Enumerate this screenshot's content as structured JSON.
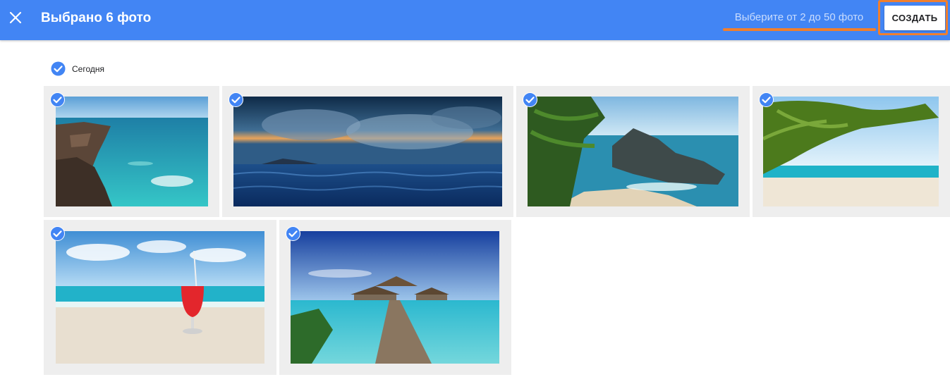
{
  "header": {
    "title": "Выбрано 6 фото",
    "hint": "Выберите от 2 до 50 фото",
    "create_label": "СОЗДАТЬ",
    "close_icon": "close-icon"
  },
  "section": {
    "date_label": "Сегодня",
    "check_icon": "check-circle-icon"
  },
  "colors": {
    "accent": "#4285f4",
    "highlight": "#f07f2e",
    "tile_background": "#eeeeee"
  },
  "photos": [
    {
      "name": "rocky-coast-turquoise-sea",
      "selected": true
    },
    {
      "name": "sunset-over-ocean",
      "selected": true
    },
    {
      "name": "palm-and-rocky-cove",
      "selected": true
    },
    {
      "name": "palm-on-white-beach",
      "selected": true
    },
    {
      "name": "red-cocktail-on-beach",
      "selected": true
    },
    {
      "name": "pier-to-water-bungalows",
      "selected": true
    }
  ]
}
